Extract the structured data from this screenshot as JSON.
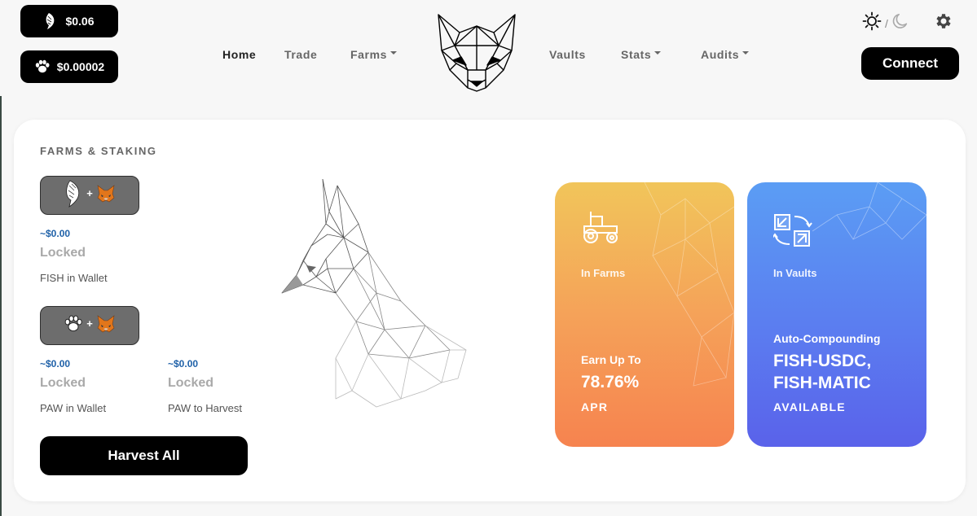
{
  "prices": {
    "fish_price": "$0.06",
    "paw_price": "$0.00002"
  },
  "nav": {
    "home": "Home",
    "trade": "Trade",
    "farms": "Farms",
    "vaults": "Vaults",
    "stats": "Stats",
    "audits": "Audits"
  },
  "header": {
    "theme_separator": "/",
    "connect_label": "Connect"
  },
  "farms_staking": {
    "title": "FARMS & STAKING",
    "fish": {
      "usd_value": "~$0.00",
      "amount": "Locked",
      "label": "FISH in Wallet"
    },
    "paw": {
      "wallet_usd": "~$0.00",
      "wallet_amount": "Locked",
      "wallet_label": "PAW in Wallet",
      "harvest_usd": "~$0.00",
      "harvest_amount": "Locked",
      "harvest_label": "PAW to Harvest"
    },
    "harvest_all_label": "Harvest All",
    "plus_sign": "+"
  },
  "farms_card": {
    "subtitle": "In Farms",
    "earn_label": "Earn Up To",
    "apr_value": "78.76%",
    "apr_label": "APR"
  },
  "vaults_card": {
    "subtitle": "In Vaults",
    "heading": "Auto-Compounding",
    "pair_1": "FISH-USDC,",
    "pair_2": "FISH-MATIC",
    "footer": "AVAILABLE"
  },
  "colors": {
    "accent_blue": "#1f61a8",
    "farms_gradient_top": "#f1c55a",
    "farms_gradient_bottom": "#f6834f",
    "vaults_gradient_top": "#5b9df4",
    "vaults_gradient_bottom": "#5a62ea"
  },
  "icons": [
    "fish-icon",
    "paw-icon",
    "fox-icon",
    "sun-icon",
    "moon-icon",
    "gear-icon",
    "tractor-icon",
    "vault-swap-icon",
    "cat-logo-icon"
  ]
}
